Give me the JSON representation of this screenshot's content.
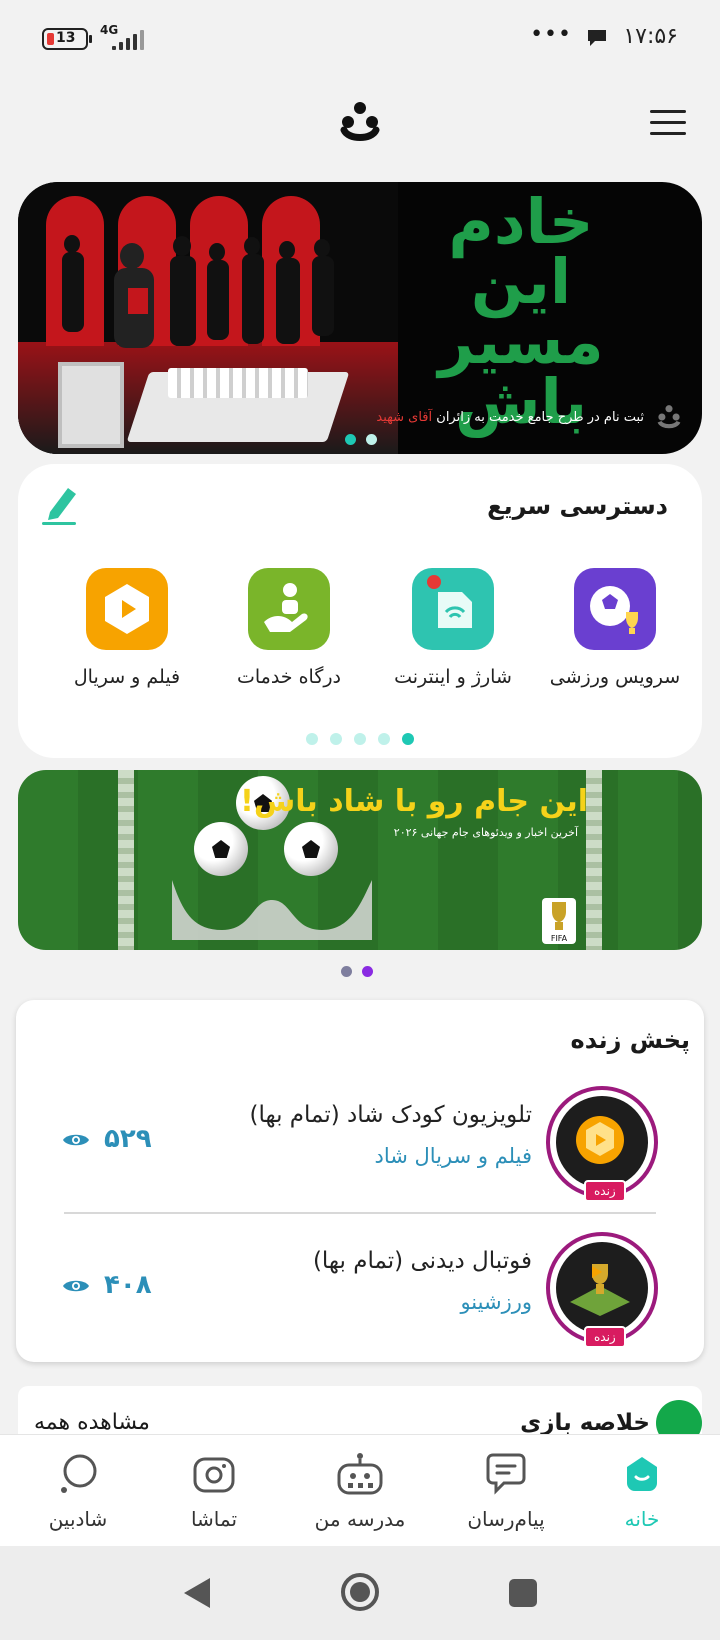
{
  "status_bar": {
    "battery": "13",
    "network": "4G",
    "time": "۱۷:۵۶",
    "more": "•••"
  },
  "header": {
    "logo_icon": "shad-logo-icon",
    "menu_icon": "hamburger-menu-icon"
  },
  "banner_top": {
    "title": "خادم این مسیر باش",
    "subtitle": "ثبت نام در طرح جامع خدمت به زائران",
    "subtitle_highlight": "آقای شهید",
    "accent": "#1f9e4a",
    "dots_active_color": "#1ec8b4"
  },
  "quick_access": {
    "title": "دسترسی سریع",
    "edit_icon": "pencil-icon",
    "items": [
      {
        "label": "سرویس ورزشی",
        "icon": "soccer-trophy-icon",
        "color": "#6a3fd0"
      },
      {
        "label": "شارژ و اینترنت",
        "icon": "sim-wifi-icon",
        "color": "#2ec4b0"
      },
      {
        "label": "درگاه خدمات",
        "icon": "service-hand-icon",
        "color": "#7ab52a"
      },
      {
        "label": "فیلم و سریال",
        "icon": "play-video-icon",
        "color": "#f7a300"
      }
    ]
  },
  "banner_world_cup": {
    "title": "این جام رو با شاد باش!",
    "subtitle": "آخرین اخبار و ویدئوهای جام جهانی ۲۰۲۶",
    "badge": "FIFA"
  },
  "live": {
    "title": "پخش زنده",
    "badge": "زنده",
    "items": [
      {
        "name": "تلویزیون کودک شاد (تمام بها)",
        "category": "فیلم و سریال شاد",
        "views": "۵۲۹"
      },
      {
        "name": "فوتبال دیدنی (تمام بها)",
        "category": "ورزشینو",
        "views": "۴۰۸"
      }
    ]
  },
  "summary": {
    "title": "خلاصه بازی",
    "see_all": "مشاهده همه"
  },
  "bottom_nav": {
    "items": [
      {
        "label": "خانه",
        "icon": "home-icon",
        "active": true
      },
      {
        "label": "پیام‌رسان",
        "icon": "messenger-icon",
        "active": false
      },
      {
        "label": "مدرسه من",
        "icon": "school-tv-icon",
        "active": false
      },
      {
        "label": "تماشا",
        "icon": "camera-icon",
        "active": false
      },
      {
        "label": "شادبین",
        "icon": "magnifier-icon",
        "active": false
      }
    ]
  }
}
